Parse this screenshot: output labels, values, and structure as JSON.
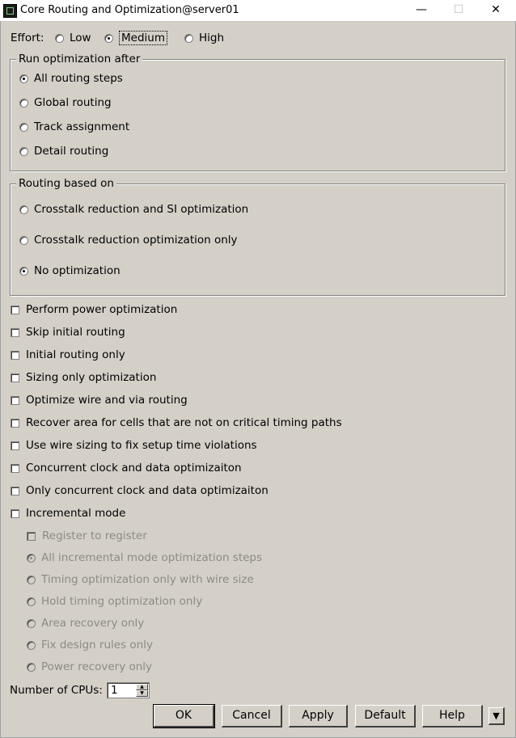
{
  "window": {
    "title": "Core Routing and Optimization@server01",
    "minimize": "—",
    "maximize": "☐",
    "close": "✕"
  },
  "effort": {
    "label": "Effort:",
    "options": [
      {
        "label": "Low",
        "checked": false
      },
      {
        "label": "Medium",
        "checked": true
      },
      {
        "label": "High",
        "checked": false
      }
    ]
  },
  "run_after": {
    "legend": "Run optimization after",
    "options": [
      {
        "label": "All routing steps",
        "checked": true
      },
      {
        "label": "Global routing",
        "checked": false
      },
      {
        "label": "Track assignment",
        "checked": false
      },
      {
        "label": "Detail routing",
        "checked": false
      }
    ]
  },
  "routing_based": {
    "legend": "Routing based on",
    "options": [
      {
        "label": "Crosstalk reduction and SI optimization",
        "checked": false
      },
      {
        "label": "Crosstalk reduction optimization only",
        "checked": false
      },
      {
        "label": "No optimization",
        "checked": true
      }
    ]
  },
  "checkboxes": [
    {
      "label": "Perform power optimization",
      "checked": false
    },
    {
      "label": "Skip initial routing",
      "checked": false
    },
    {
      "label": "Initial routing only",
      "checked": false
    },
    {
      "label": "Sizing only optimization",
      "checked": false
    },
    {
      "label": "Optimize wire and via routing",
      "checked": false
    },
    {
      "label": "Recover area for cells that are not on critical timing paths",
      "checked": false
    },
    {
      "label": "Use wire sizing to fix setup time violations",
      "checked": false
    },
    {
      "label": "Concurrent clock and data optimizaiton",
      "checked": false
    },
    {
      "label": "Only concurrent clock and data optimizaiton",
      "checked": false
    },
    {
      "label": "Incremental mode",
      "checked": false
    }
  ],
  "incremental": {
    "register_to_register": {
      "label": "Register to register",
      "checked": false,
      "enabled": false
    },
    "options": [
      {
        "label": "All incremental mode optimization steps",
        "checked": true
      },
      {
        "label": "Timing optimization only with wire size",
        "checked": false
      },
      {
        "label": "Hold timing optimization only",
        "checked": false
      },
      {
        "label": "Area recovery only",
        "checked": false
      },
      {
        "label": "Fix design rules only",
        "checked": false
      },
      {
        "label": "Power recovery only",
        "checked": false
      }
    ]
  },
  "cpus": {
    "label": "Number of CPUs:",
    "value": "1"
  },
  "buttons": {
    "ok": "OK",
    "cancel": "Cancel",
    "apply": "Apply",
    "default": "Default",
    "help": "Help"
  }
}
